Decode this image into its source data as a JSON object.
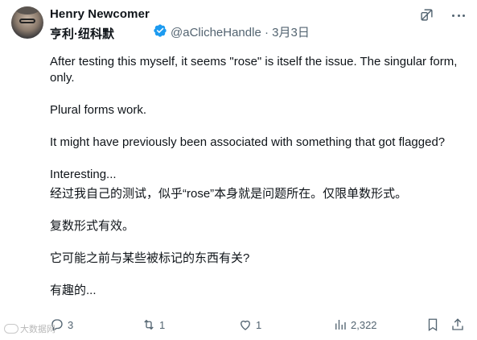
{
  "author": {
    "name": "Henry Newcomer",
    "name_zh": "亨利·纽科默",
    "handle": "@aClicheHandle",
    "separator": "·",
    "date": "3月3日",
    "verified_color": "#1d9bf0"
  },
  "icons": {
    "grok": "grok-icon",
    "more": "more-icon",
    "verified": "verified-badge-icon"
  },
  "body": {
    "p1": "After testing this myself, it seems \"rose\" is itself the issue. The singular form, only.",
    "p2": "Plural forms work.",
    "p3": "It might have previously been associated with something that got flagged?",
    "p4": "Interesting...",
    "zh1": "经过我自己的测试，似乎“rose”本身就是问题所在。仅限单数形式。",
    "zh2": "复数形式有效。",
    "zh3": "它可能之前与某些被标记的东西有关?",
    "zh4": "有趣的..."
  },
  "actions": {
    "replies": "3",
    "retweets": "1",
    "likes": "1",
    "views": "2,322"
  },
  "watermark": {
    "text": "大数据网"
  },
  "colors": {
    "text": "#0f1419",
    "secondary": "#536471"
  }
}
